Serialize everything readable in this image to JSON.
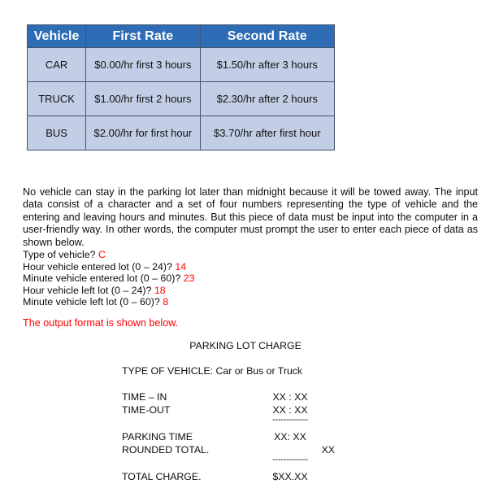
{
  "rate_table": {
    "headers": [
      "Vehicle",
      "First Rate",
      "Second Rate"
    ],
    "rows": [
      {
        "vehicle": "CAR",
        "first_rate": "$0.00/hr first 3 hours",
        "second_rate": "$1.50/hr after 3 hours"
      },
      {
        "vehicle": "TRUCK",
        "first_rate": "$1.00/hr first 2 hours",
        "second_rate": "$2.30/hr after 2 hours"
      },
      {
        "vehicle": "BUS",
        "first_rate": "$2.00/hr for first hour",
        "second_rate": "$3.70/hr after first hour"
      }
    ],
    "header_bg": "#2e6cb5",
    "cell_bg": "#c2cee6",
    "border_color": "#44546a"
  },
  "body_paragraph": "No vehicle can stay in the parking lot later than midnight because it will be towed away. The input data consist of a character and a set of four numbers representing the type of vehicle and the entering and leaving hours and minutes. But this piece of data must be input into the computer in a user-friendly way. In other words, the computer must prompt the user to enter each piece of data as shown below.",
  "prompts": [
    {
      "label": "Type of vehicle?",
      "answer": "C"
    },
    {
      "label": "Hour vehicle entered lot (0 – 24)?",
      "answer": "14"
    },
    {
      "label": "Minute vehicle entered lot (0 – 60)?",
      "answer": "23"
    },
    {
      "label": "Hour vehicle left lot (0 – 24)?",
      "answer": "18"
    },
    {
      "label": "Minute vehicle left lot (0 – 60)?",
      "answer": "8"
    }
  ],
  "answer_color": "#ff0000",
  "output_note": "The output format is shown below.",
  "output_sample": {
    "title": "PARKING LOT CHARGE",
    "vehicle_type_line": "TYPE OF VEHICLE: Car or Bus or Truck",
    "time_in_label": "TIME – IN",
    "time_in_value": "XX  :  XX",
    "time_out_label": "TIME-OUT",
    "time_out_value": "XX  :  XX",
    "rule_upper": "-------------",
    "parking_time_label": "PARKING TIME",
    "parking_time_value": "XX: XX",
    "rounded_total_label": "ROUNDED TOTAL.",
    "rounded_total_value": "XX",
    "rule_lower": "-------------",
    "total_charge_label": "TOTAL CHARGE.",
    "total_charge_value": "$XX.XX"
  }
}
